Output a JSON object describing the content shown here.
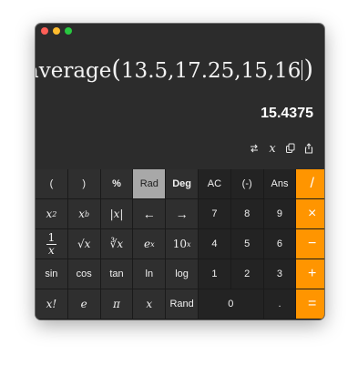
{
  "expression": {
    "func": "average",
    "open_paren": "(",
    "args": "13.5,17.25,15,16",
    "close_paren": ")"
  },
  "result": "15.4375",
  "toolbar": [
    {
      "icon": "swap-icon"
    },
    {
      "icon": "variable-x-icon",
      "glyph": "x"
    },
    {
      "icon": "copy-icon"
    },
    {
      "icon": "share-icon"
    }
  ],
  "keys": {
    "r1": [
      "(",
      ")",
      "%",
      "Rad",
      "Deg",
      "AC",
      "(-)",
      "Ans",
      "/"
    ],
    "r2": [
      "x2",
      "xb",
      "|x|",
      "←",
      "→",
      "7",
      "8",
      "9",
      "×"
    ],
    "r3": [
      "1/x",
      "√x",
      "∛x",
      "ex",
      "10x",
      "4",
      "5",
      "6",
      "−"
    ],
    "r4": [
      "sin",
      "cos",
      "tan",
      "ln",
      "log",
      "1",
      "2",
      "3",
      "+"
    ],
    "r5": [
      "x!",
      "e",
      "π",
      "x",
      "Rand",
      "0",
      ".",
      "="
    ]
  },
  "key_parts": {
    "x2_base": "x",
    "x2_exp": "2",
    "xb_base": "x",
    "xb_exp": "b",
    "abs": "|x|",
    "recip_num": "1",
    "recip_den": "x",
    "sqrt": "√x",
    "cbrt_idx": "∛",
    "cbrt_x": "x",
    "ex_base": "e",
    "ex_exp": "x",
    "tenx_base": "10",
    "tenx_exp": "x",
    "fact": "x!",
    "e": "e",
    "pi": "π",
    "x": "x"
  },
  "colors": {
    "operator": "#ff9500",
    "active_key": "#a8a8a8",
    "scientific_key": "#2f2f2f",
    "number_key": "#232323"
  }
}
